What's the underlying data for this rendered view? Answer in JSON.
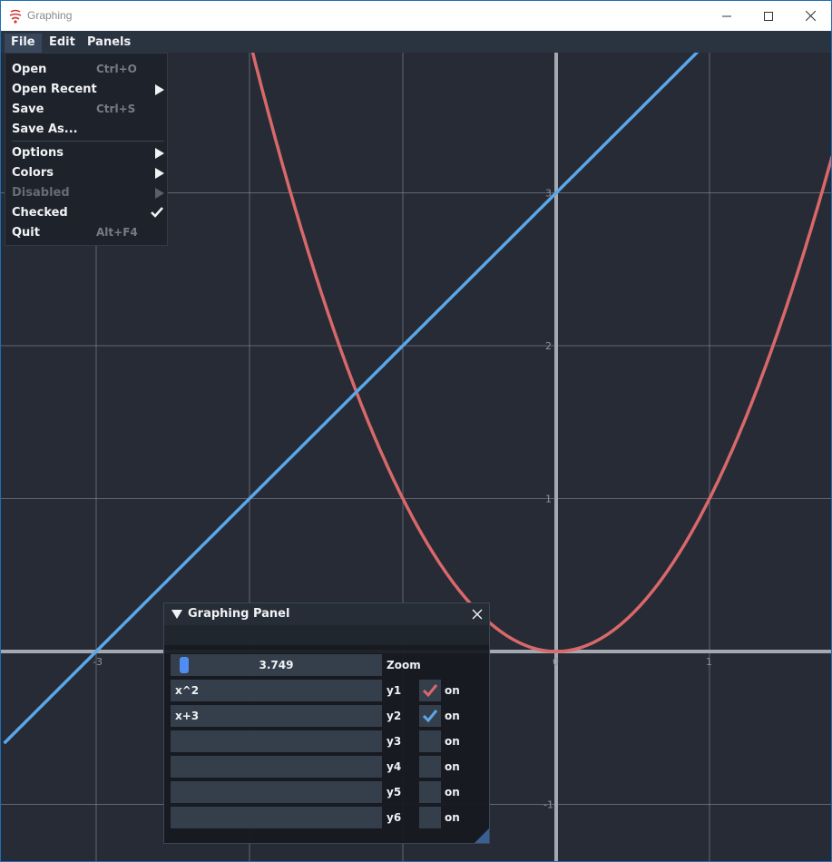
{
  "window": {
    "title": "Graphing"
  },
  "menubar": {
    "file": "File",
    "edit": "Edit",
    "panels": "Panels"
  },
  "file_menu": {
    "items": [
      {
        "label": "Open",
        "shortcut": "Ctrl+O"
      },
      {
        "label": "Open Recent",
        "shortcut": ""
      },
      {
        "label": "Save",
        "shortcut": "Ctrl+S"
      },
      {
        "label": "Save As...",
        "shortcut": ""
      },
      {
        "label": "Options",
        "shortcut": ""
      },
      {
        "label": "Colors",
        "shortcut": ""
      },
      {
        "label": "Disabled",
        "shortcut": "",
        "disabled": true
      },
      {
        "label": "Checked",
        "shortcut": "",
        "checked": true
      },
      {
        "label": "Quit",
        "shortcut": "Alt+F4"
      }
    ]
  },
  "graph": {
    "x_range": [
      -3.6,
      1.8
    ],
    "y_range": [
      -1.35,
      3.9
    ],
    "x_tick_labels": [
      "-3",
      "0",
      "1"
    ],
    "y_tick_labels": [
      "3",
      "2",
      "1",
      "-1"
    ],
    "curves": [
      {
        "expr": "x^2",
        "color": "#d9686a"
      },
      {
        "expr": "x+3",
        "color": "#5aa7ea"
      }
    ],
    "colors": {
      "background": "#262b36",
      "grid": "#888d97",
      "axis": "#a4a8b0"
    }
  },
  "panel": {
    "title": "Graphing Panel",
    "zoom": {
      "value": "3.749",
      "label": "Zoom",
      "fraction": 0.03
    },
    "functions": [
      {
        "expr": "x^2",
        "label": "y1",
        "checked": true,
        "color": "#d9686a",
        "toggle": "on"
      },
      {
        "expr": "x+3",
        "label": "y2",
        "checked": true,
        "color": "#5aa7ea",
        "toggle": "on"
      },
      {
        "expr": "",
        "label": "y3",
        "checked": false,
        "color": "",
        "toggle": "on"
      },
      {
        "expr": "",
        "label": "y4",
        "checked": false,
        "color": "",
        "toggle": "on"
      },
      {
        "expr": "",
        "label": "y5",
        "checked": false,
        "color": "",
        "toggle": "on"
      },
      {
        "expr": "",
        "label": "y6",
        "checked": false,
        "color": "",
        "toggle": "on"
      }
    ]
  }
}
